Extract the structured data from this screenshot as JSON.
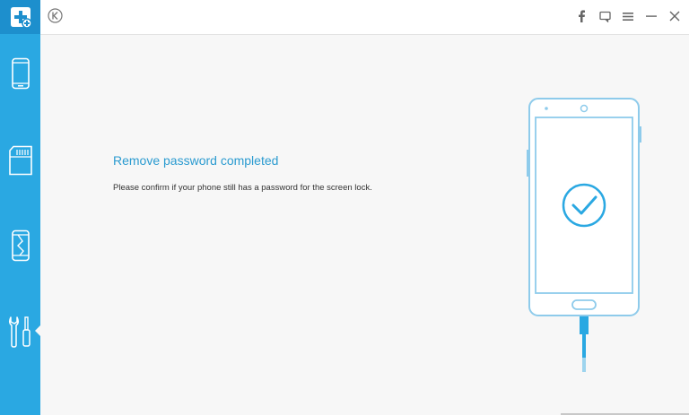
{
  "main": {
    "title": "Remove password completed",
    "description": "Please confirm if your phone still has a password for the screen lock."
  },
  "sidebar": {
    "items": [
      {
        "icon": "phone-icon"
      },
      {
        "icon": "sd-card-icon"
      },
      {
        "icon": "broken-phone-icon"
      },
      {
        "icon": "tools-icon",
        "active": true
      }
    ]
  },
  "topbar": {
    "icons": [
      "back-icon",
      "facebook-icon",
      "feedback-icon",
      "menu-icon",
      "minimize-icon",
      "close-icon"
    ]
  },
  "colors": {
    "sidebar": "#2aa8e2",
    "logo_bg": "#1d8fcd",
    "accent": "#2b9bd0"
  }
}
